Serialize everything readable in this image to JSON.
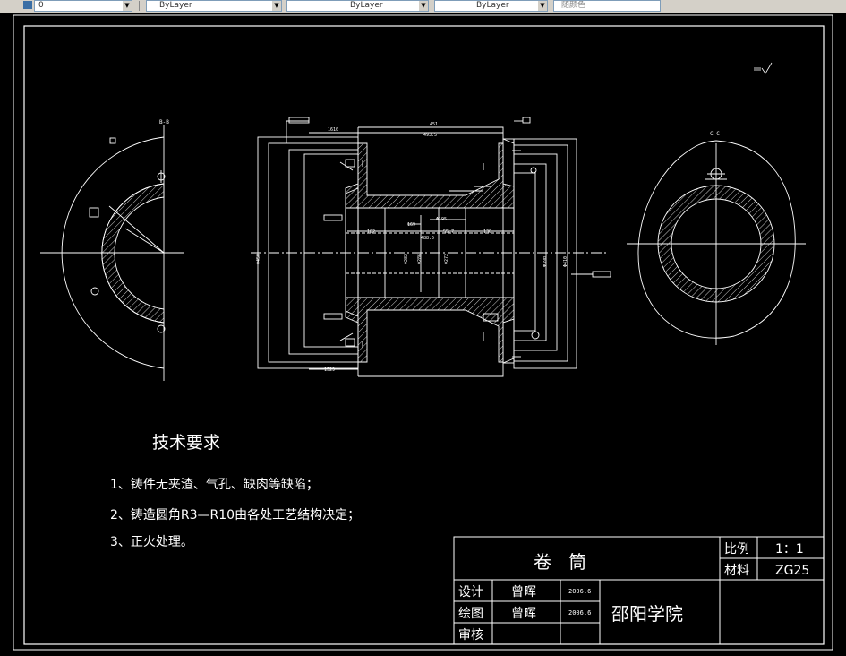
{
  "toolbar": {
    "combo_1": "ByLayer",
    "combo_2": "ByLayer",
    "combo_3": "ByLayer",
    "combo_4": "随颜色"
  },
  "drawing": {
    "section_labels": {
      "left_view": "B-B",
      "right_view": "C-C"
    },
    "tech_title": "技术要求",
    "tech_items": [
      "1、铸件无夹渣、气孔、缺肉等缺陷；",
      "2、铸造圆角R3—R10由各处工艺结构决定；",
      "3、正火处理。"
    ],
    "title_block": {
      "part_name": "卷   筒",
      "scale_label": "比例",
      "scale_value": "1：1",
      "material_label": "材料",
      "material_value": "ZG25",
      "design_label": "设计",
      "draw_label": "绘图",
      "review_label": "审核",
      "designer": "曾晖",
      "drawer": "曾晖",
      "design_date": "2006.6",
      "draw_date": "2006.6",
      "school": "邵阳学院"
    },
    "dimensions": {
      "d_top_overall": "1610",
      "d_top_span": "451",
      "d_inner_top": "493.5",
      "d_bore": "Φ195",
      "d_left": "Φ450",
      "d_mid1": "Φ282",
      "d_mid2": "Φ286",
      "d_mid3": "Φ272",
      "d_right1": "Φ390",
      "d_right2": "Φ410",
      "d_bottom": "1529",
      "d_len1": "130",
      "d_len2": "102",
      "d_len3": "169",
      "d_len4": "488.5",
      "d_len5": "55.7"
    }
  }
}
